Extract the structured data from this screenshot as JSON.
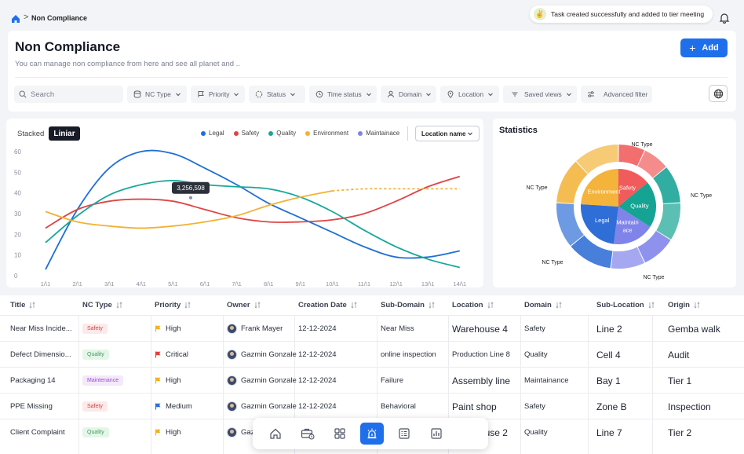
{
  "breadcrumb": {
    "current": "Non Compliance",
    "separator": ">"
  },
  "toast": {
    "message": "Task created successfully and added to tier meeting",
    "emoji": "✌"
  },
  "page": {
    "title": "Non Compliance",
    "subtitle": "You can manage non compliance from here and see all planet and ..",
    "add_label": "Add"
  },
  "filters": {
    "search_placeholder": "Search",
    "nc_type": "NC Type",
    "priority": "Priority",
    "status": "Status",
    "time_status": "Time status",
    "domain": "Domain",
    "location": "Location",
    "saved_views": "Saved views",
    "advanced": "Advanced filter"
  },
  "chart_toolbar": {
    "stacked": "Stacked",
    "liniar": "Liniar",
    "location_select": "Location name"
  },
  "colors": {
    "accent": "#1f6feb",
    "legal": "#1f6fd6",
    "safety": "#e04444",
    "quality": "#17a89a",
    "environment": "#f2b233",
    "maintainace": "#7f83ea"
  },
  "chart_data": {
    "type": "line",
    "x": [
      "1/1",
      "2/1",
      "3/1",
      "4/1",
      "5/1",
      "6/1",
      "7/1",
      "8/1",
      "9/1",
      "10/1",
      "11/1",
      "12/1",
      "13/1",
      "14/1"
    ],
    "x_tick_labels": [
      "1/\\1",
      "2/\\1",
      "3/\\1",
      "4/\\1",
      "5/\\1",
      "6/\\1",
      "7/\\1",
      "8/\\1",
      "9/\\1",
      "10/\\1",
      "11/\\1",
      "12/\\1",
      "13/\\1",
      "14/\\1"
    ],
    "yticks": [
      0,
      10,
      20,
      30,
      40,
      50,
      60
    ],
    "ylim": [
      0,
      60
    ],
    "series": [
      {
        "name": "Legal",
        "color": "#1f6fd6",
        "values": [
          3,
          32,
          52,
          60,
          59,
          52,
          44,
          35,
          28,
          21,
          14,
          9,
          9,
          12
        ]
      },
      {
        "name": "Safety",
        "color": "#e04444",
        "values": [
          23,
          32,
          36,
          37,
          36,
          32,
          28,
          26,
          26,
          27,
          30,
          36,
          43,
          48
        ]
      },
      {
        "name": "Quality",
        "color": "#17a89a",
        "values": [
          16,
          29,
          39,
          44,
          46,
          44,
          43,
          42,
          38,
          31,
          22,
          14,
          8,
          4
        ]
      },
      {
        "name": "Environment",
        "color": "#f2b233",
        "values": [
          31,
          26,
          24,
          23,
          24,
          26,
          29,
          34,
          38,
          41,
          42,
          42,
          42,
          42
        ],
        "dashed_from_index": 9
      }
    ],
    "tooltip": {
      "text": "3,256,598",
      "x_index": 5
    }
  },
  "legend": [
    "Legal",
    "Safety",
    "Quality",
    "Environment",
    "Maintainace"
  ],
  "statistics": {
    "title": "Statistics",
    "inner": [
      {
        "label": "Safety",
        "value": 14,
        "color": "#f15b5b"
      },
      {
        "label": "Quality",
        "value": 20,
        "color": "#15a394"
      },
      {
        "label": "Maintain ace",
        "value": 18,
        "color": "#7f83ea"
      },
      {
        "label": "Legal",
        "value": 24,
        "color": "#2f6ed6"
      },
      {
        "label": "Environment",
        "value": 24,
        "color": "#f4b33a"
      }
    ],
    "outer_labels": [
      "NC Type",
      "NC Type",
      "NC Type",
      "NC Type",
      "NC Type"
    ]
  },
  "table": {
    "headers": [
      "Title",
      "NC Type",
      "Priority",
      "Owner",
      "Creation Date",
      "Sub-Domain",
      "Location",
      "Domain",
      "Sub-Location",
      "Origin"
    ],
    "rows": [
      {
        "title": "Near Miss Incide...",
        "nc_type": "Safety",
        "priority": "High",
        "owner": "Frank Mayer",
        "date": "12-12-2024",
        "sub_domain": "Near Miss",
        "location": "Warehouse 4",
        "domain": "Safety",
        "sub_location": "Line 2",
        "origin": "Gemba walk"
      },
      {
        "title": "Defect Dimensio...",
        "nc_type": "Quality",
        "priority": "Critical",
        "owner": "Gazmin Gonzale",
        "date": "12-12-2024",
        "sub_domain": "online inspection",
        "location": "Production Line 8",
        "domain": "Quality",
        "sub_location": "Cell 4",
        "origin": "Audit"
      },
      {
        "title": "Packaging 14",
        "nc_type": "Maintenance",
        "priority": "High",
        "owner": "Gazmin Gonzale",
        "date": "12-12-2024",
        "sub_domain": "Failure",
        "location": "Assembly line",
        "domain": "Maintainance",
        "sub_location": "Bay 1",
        "origin": "Tier 1"
      },
      {
        "title": "PPE Missing",
        "nc_type": "Safety",
        "priority": "Medium",
        "owner": "Gazmin Gonzale",
        "date": "12-12-2024",
        "sub_domain": "Behavioral",
        "location": "Paint shop",
        "domain": "Safety",
        "sub_location": "Zone B",
        "origin": "Inspection"
      },
      {
        "title": "Client Complaint",
        "nc_type": "Quality",
        "priority": "High",
        "owner": "Gazmin Gonzale",
        "date": "12-12-2024",
        "sub_domain": "",
        "location": "Warehouse 2",
        "domain": "Quality",
        "sub_location": "Line 7",
        "origin": "Tier 2"
      }
    ]
  },
  "dock": [
    "home-icon",
    "briefcase-icon",
    "grid-icon",
    "alarm-icon",
    "list-icon",
    "chart-icon"
  ]
}
